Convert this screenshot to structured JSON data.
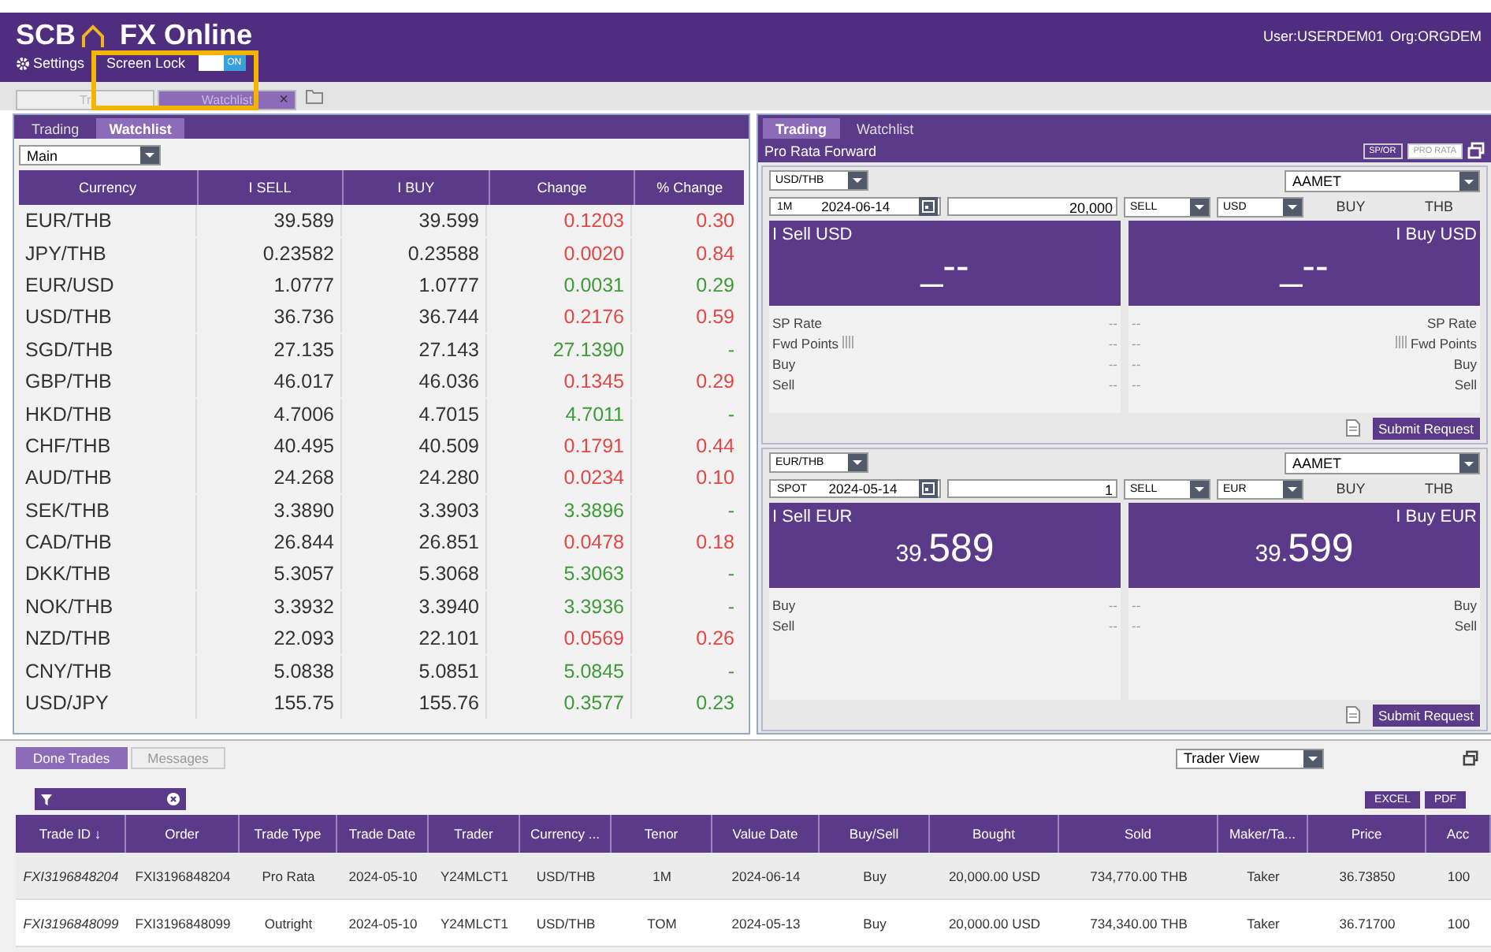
{
  "header": {
    "brand": "SCB",
    "product": "FX Online",
    "user": "User:USERDEM01",
    "org": "Org:ORGDEM",
    "settings": "Settings",
    "screen_lock": {
      "label": "Screen Lock",
      "on": true,
      "state_text": "ON"
    }
  },
  "workspace_tabs": [
    {
      "label": "Tr",
      "selected": false
    },
    {
      "label": "Watchlist",
      "selected": true,
      "close": "×"
    }
  ],
  "left_panel": {
    "tabs": [
      {
        "label": "Trading",
        "selected": false
      },
      {
        "label": "Watchlist",
        "selected": true
      }
    ],
    "list_select": "Main",
    "columns": [
      "Currency",
      "I SELL",
      "I BUY",
      "Change",
      "% Change"
    ],
    "rows": [
      {
        "pair": "EUR/THB",
        "sell": "39.589",
        "buy": "39.599",
        "change": "0.1203",
        "pct": "0.30",
        "color": "#e04848"
      },
      {
        "pair": "JPY/THB",
        "sell": "0.23582",
        "buy": "0.23588",
        "change": "0.0020",
        "pct": "0.84",
        "color": "#e04848"
      },
      {
        "pair": "EUR/USD",
        "sell": "1.0777",
        "buy": "1.0777",
        "change": "0.0031",
        "pct": "0.29",
        "color": "#3f9a3a"
      },
      {
        "pair": "USD/THB",
        "sell": "36.736",
        "buy": "36.744",
        "change": "0.2176",
        "pct": "0.59",
        "color": "#e04848"
      },
      {
        "pair": "SGD/THB",
        "sell": "27.135",
        "buy": "27.143",
        "change": "27.1390",
        "pct": "-",
        "color": "#3f9a3a"
      },
      {
        "pair": "GBP/THB",
        "sell": "46.017",
        "buy": "46.036",
        "change": "0.1345",
        "pct": "0.29",
        "color": "#e04848"
      },
      {
        "pair": "HKD/THB",
        "sell": "4.7006",
        "buy": "4.7015",
        "change": "4.7011",
        "pct": "-",
        "color": "#3f9a3a"
      },
      {
        "pair": "CHF/THB",
        "sell": "40.495",
        "buy": "40.509",
        "change": "0.1791",
        "pct": "0.44",
        "color": "#e04848"
      },
      {
        "pair": "AUD/THB",
        "sell": "24.268",
        "buy": "24.280",
        "change": "0.0234",
        "pct": "0.10",
        "color": "#e04848"
      },
      {
        "pair": "SEK/THB",
        "sell": "3.3890",
        "buy": "3.3903",
        "change": "3.3896",
        "pct": "-",
        "color": "#3f9a3a"
      },
      {
        "pair": "CAD/THB",
        "sell": "26.844",
        "buy": "26.851",
        "change": "0.0478",
        "pct": "0.18",
        "color": "#e04848"
      },
      {
        "pair": "DKK/THB",
        "sell": "5.3057",
        "buy": "5.3068",
        "change": "5.3063",
        "pct": "-",
        "color": "#3f9a3a"
      },
      {
        "pair": "NOK/THB",
        "sell": "3.3932",
        "buy": "3.3940",
        "change": "3.3936",
        "pct": "-",
        "color": "#3f9a3a"
      },
      {
        "pair": "NZD/THB",
        "sell": "22.093",
        "buy": "22.101",
        "change": "0.0569",
        "pct": "0.26",
        "color": "#e04848"
      },
      {
        "pair": "CNY/THB",
        "sell": "5.0838",
        "buy": "5.0851",
        "change": "5.0845",
        "pct": "-",
        "color": "#3f9a3a"
      },
      {
        "pair": "USD/JPY",
        "sell": "155.75",
        "buy": "155.76",
        "change": "0.3577",
        "pct": "0.23",
        "color": "#3f9a3a"
      }
    ]
  },
  "right_panel": {
    "tabs": [
      {
        "label": "Trading",
        "selected": true
      },
      {
        "label": "Watchlist",
        "selected": false
      }
    ],
    "title": "Pro Rata Forward",
    "modes": [
      {
        "label": "SP/OR",
        "selected": false
      },
      {
        "label": "PRO RATA",
        "selected": true
      }
    ],
    "tickets": [
      {
        "pair": "USD/THB",
        "counterparty": "AAMET",
        "tenor": "1M",
        "date": "2024-06-14",
        "amount": "20,000",
        "side": "SELL",
        "currency": "USD",
        "opposite_side": "BUY",
        "opposite_currency": "THB",
        "sell_title": "I Sell USD",
        "buy_title": "I Buy USD",
        "sell_price": {
          "big": "_--"
        },
        "buy_price": {
          "big": "_--"
        },
        "sell_details": [
          {
            "label": "SP Rate",
            "value": "--",
            "icon": false
          },
          {
            "label": "Fwd Points",
            "value": "--",
            "icon": true
          },
          {
            "label": "Buy",
            "value": "--",
            "icon": false
          },
          {
            "label": "Sell",
            "value": "--",
            "icon": false
          }
        ],
        "buy_details": [
          {
            "label": "SP Rate",
            "value": "--",
            "icon": false
          },
          {
            "label": "Fwd Points",
            "value": "--",
            "icon": true
          },
          {
            "label": "Buy",
            "value": "--",
            "icon": false
          },
          {
            "label": "Sell",
            "value": "--",
            "icon": false
          }
        ],
        "submit": "Submit Request"
      },
      {
        "pair": "EUR/THB",
        "counterparty": "AAMET",
        "tenor": "SPOT",
        "date": "2024-05-14",
        "amount": "1",
        "side": "SELL",
        "currency": "EUR",
        "opposite_side": "BUY",
        "opposite_currency": "THB",
        "sell_title": "I Sell EUR",
        "buy_title": "I Buy EUR",
        "sell_price": {
          "small": "39.",
          "big": "589"
        },
        "buy_price": {
          "small": "39.",
          "big": "599"
        },
        "sell_details": [
          {
            "label": "Buy",
            "value": "--",
            "icon": false
          },
          {
            "label": "Sell",
            "value": "--",
            "icon": false
          }
        ],
        "buy_details": [
          {
            "label": "Buy",
            "value": "--",
            "icon": false
          },
          {
            "label": "Sell",
            "value": "--",
            "icon": false
          }
        ],
        "submit": "Submit Request"
      }
    ]
  },
  "bottom_panel": {
    "tabs": [
      {
        "label": "Done Trades",
        "selected": true
      },
      {
        "label": "Messages",
        "selected": false
      }
    ],
    "view_select": "Trader View",
    "exports": [
      "EXCEL",
      "PDF"
    ],
    "columns": [
      "Trade ID ↓",
      "Order",
      "Trade Type",
      "Trade Date",
      "Trader",
      "Currency ...",
      "Tenor",
      "Value Date",
      "Buy/Sell",
      "Bought",
      "Sold",
      "Maker/Ta...",
      "Price",
      "Acc"
    ],
    "rows": [
      [
        "FXI3196848204",
        "FXI3196848204",
        "Pro Rata",
        "2024-05-10",
        "Y24MLCT1",
        "USD/THB",
        "1M",
        "2024-06-14",
        "Buy",
        "20,000.00 USD",
        "734,770.00 THB",
        "Taker",
        "36.73850",
        "100"
      ],
      [
        "FXI3196848099",
        "FXI3196848099",
        "Outright",
        "2024-05-10",
        "Y24MLCT1",
        "USD/THB",
        "TOM",
        "2024-05-13",
        "Buy",
        "20,000.00 USD",
        "734,340.00 THB",
        "Taker",
        "36.71700",
        "100"
      ]
    ]
  },
  "highlight": true
}
